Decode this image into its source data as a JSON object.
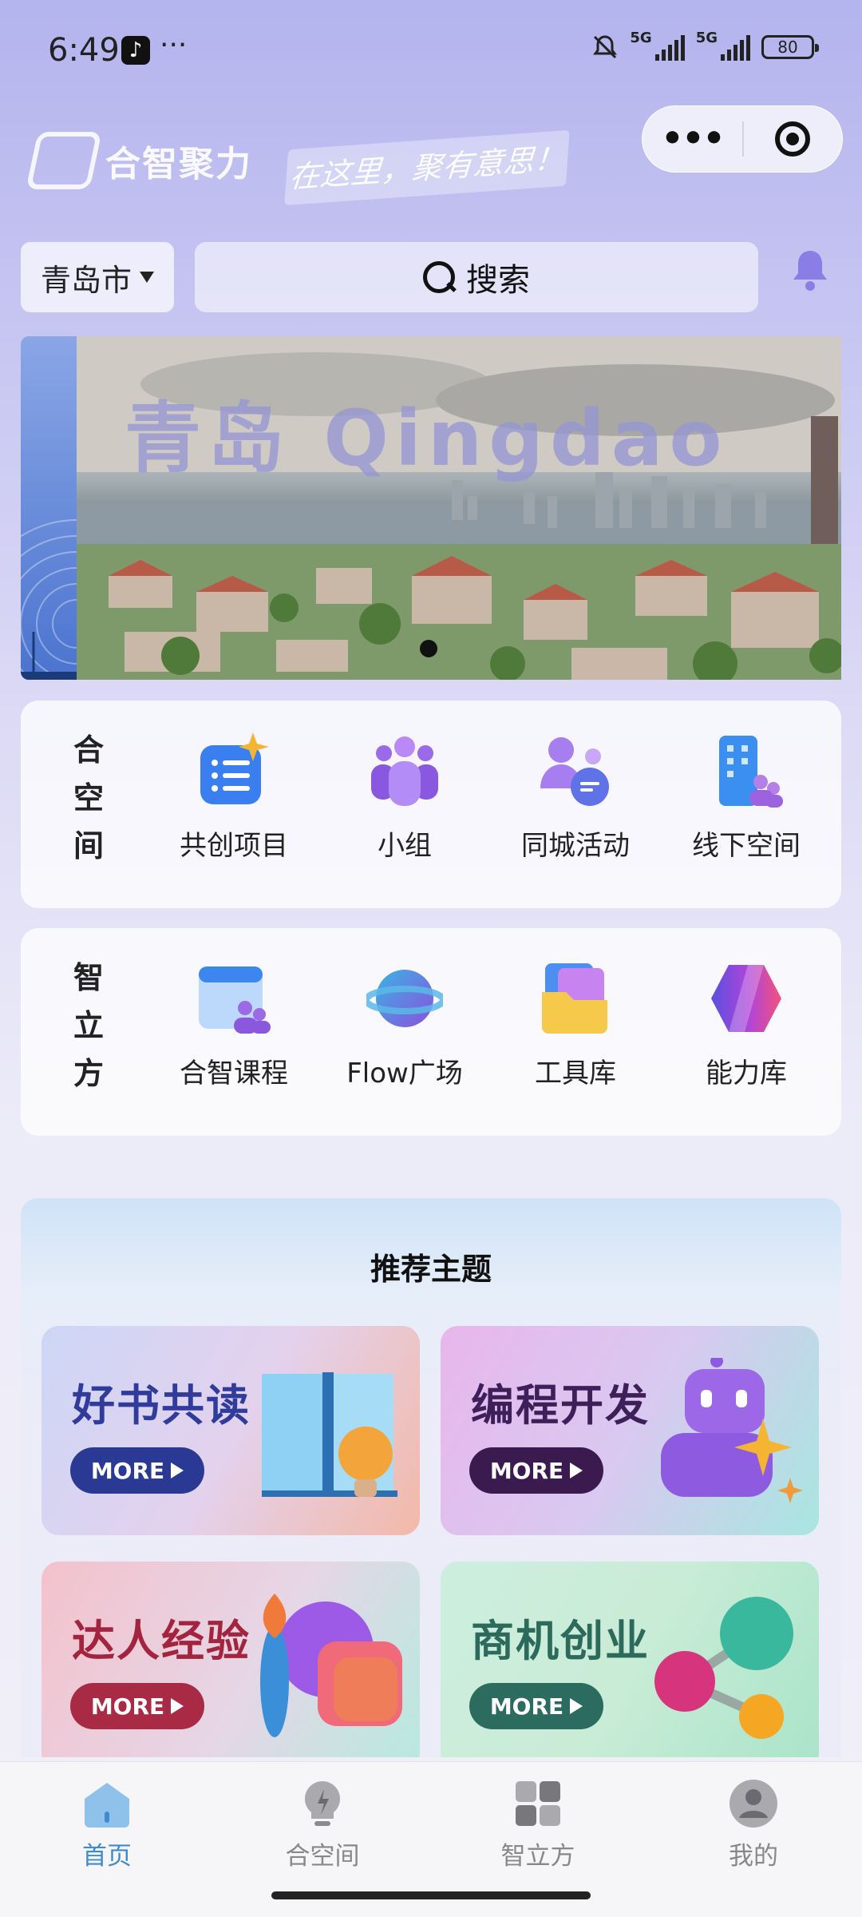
{
  "status_bar": {
    "time": "6:49",
    "more": "···",
    "network_1": "5G",
    "network_2": "5G",
    "battery": "80"
  },
  "header": {
    "logo_text": "合智聚力",
    "slogan": "在这里，聚有意思！",
    "capsule_more": "•••"
  },
  "location": {
    "city": "青岛市"
  },
  "search": {
    "label": "搜索"
  },
  "banner": {
    "title": "青岛 Qingdao"
  },
  "hekongjian": {
    "label_chars": [
      "合",
      "空",
      "间"
    ],
    "items": [
      {
        "label": "共创项目",
        "icon": "project-sparkle-icon"
      },
      {
        "label": "小组",
        "icon": "group-icon"
      },
      {
        "label": "同城活动",
        "icon": "chat-people-icon"
      },
      {
        "label": "线下空间",
        "icon": "building-icon"
      }
    ]
  },
  "zhilifang": {
    "label_chars": [
      "智",
      "立",
      "方"
    ],
    "items": [
      {
        "label": "合智课程",
        "icon": "course-icon"
      },
      {
        "label": "Flow广场",
        "icon": "planet-icon"
      },
      {
        "label": "工具库",
        "icon": "folder-icon"
      },
      {
        "label": "能力库",
        "icon": "hexagon-icon"
      }
    ]
  },
  "recommended": {
    "title": "推荐主题",
    "more_label": "MORE",
    "tiles": [
      {
        "title": "好书共读",
        "icon": "book-bulb-icon",
        "title_color": "#2f3c9c",
        "more_bg": "#2a3994"
      },
      {
        "title": "编程开发",
        "icon": "robot-icon",
        "title_color": "#3e1f5a",
        "more_bg": "#3b1a4f"
      },
      {
        "title": "达人经验",
        "icon": "palette-brush-icon",
        "title_color": "#a3243e",
        "more_bg": "#a82a45"
      },
      {
        "title": "商机创业",
        "icon": "share-nodes-icon",
        "title_color": "#2c6a5c",
        "more_bg": "#2c6b5f"
      }
    ]
  },
  "tabbar": {
    "tabs": [
      {
        "label": "首页",
        "icon": "home-icon",
        "active": true
      },
      {
        "label": "合空间",
        "icon": "bulb-icon",
        "active": false
      },
      {
        "label": "智立方",
        "icon": "grid-icon",
        "active": false
      },
      {
        "label": "我的",
        "icon": "user-icon",
        "active": false
      }
    ],
    "active_color": "#3f8bd0"
  }
}
